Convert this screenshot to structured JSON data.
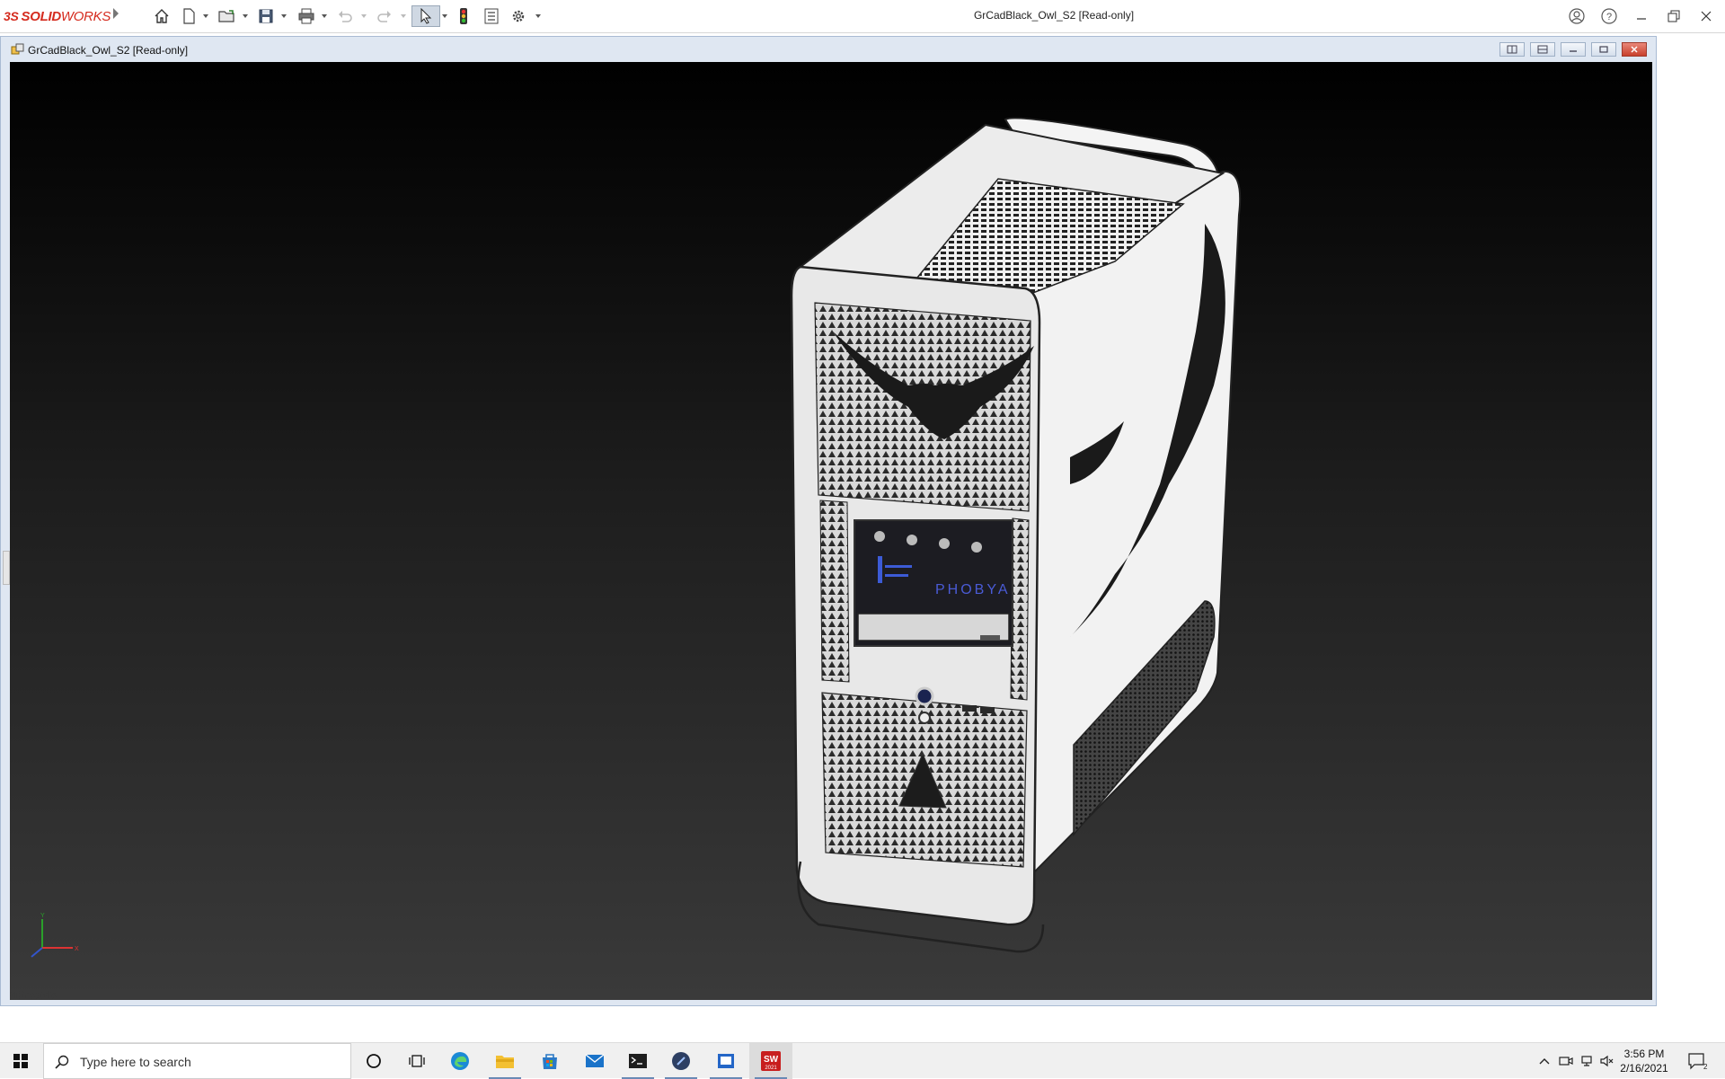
{
  "app": {
    "brand_prefix": "3S",
    "brand_bold": "SOLID",
    "brand_rest": "WORKS",
    "title": "GrCadBlack_Owl_S2 [Read-only]",
    "toolbar": [
      "home-icon",
      "new-document-icon",
      "open-icon",
      "save-icon",
      "print-icon",
      "undo-icon",
      "redo-icon",
      "select-icon",
      "rebuild-icon",
      "file-properties-icon",
      "options-icon"
    ]
  },
  "document": {
    "title": "GrCadBlack_Owl_S2 [Read-only]",
    "view_orientation": "*Dimetric",
    "model_text": "PHOBYA",
    "triad_axes": [
      "Y",
      "X"
    ]
  },
  "taskbar": {
    "search_placeholder": "Type here to search",
    "time": "3:56 PM",
    "date": "2/16/2021",
    "notification_count": "2",
    "solidworks_badge": "2021",
    "apps": [
      "cortana-icon",
      "task-view-icon",
      "edge-icon",
      "file-explorer-icon",
      "store-icon",
      "mail-icon",
      "terminal-icon",
      "app-icon",
      "window-app-icon",
      "solidworks-taskbar-icon"
    ]
  },
  "colors": {
    "brand_red": "#d52b1e",
    "viewport_top": "#000000",
    "viewport_bottom": "#3a3a3a",
    "model_body": "#f2f2f2"
  }
}
